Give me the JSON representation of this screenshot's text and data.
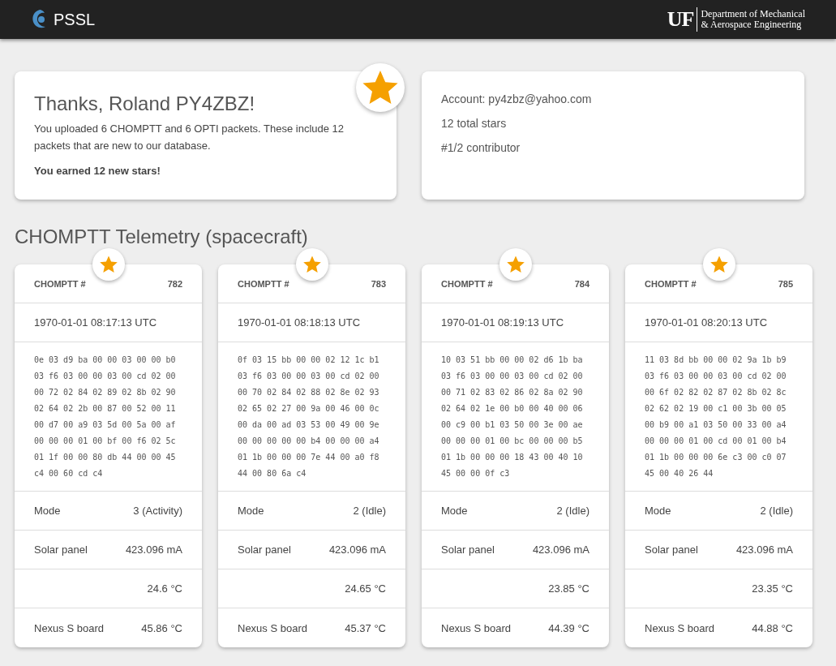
{
  "header": {
    "logo_text": "PSSL",
    "dept_line1": "Department of Mechanical",
    "dept_line2": "& Aerospace Engineering",
    "uf_text": "UF"
  },
  "thanks": {
    "title": "Thanks, Roland PY4ZBZ!",
    "message": "You uploaded 6 CHOMPTT and 6 OPTI packets. These include 12 packets that are new to our database.",
    "earned": "You earned 12 new stars!"
  },
  "account": {
    "lines": [
      "Account: py4zbz@yahoo.com",
      "12 total stars",
      "#1/2 contributor"
    ]
  },
  "section_title": "CHOMPTT Telemetry (spacecraft)",
  "packets": [
    {
      "label": "CHOMPTT #",
      "number": "782",
      "time": "1970-01-01 08:17:13 UTC",
      "hex": [
        "0e 03 d9 ba 00 00 03 00 00 b0",
        "03 f6 03 00 00 03 00 cd 02 00",
        "00 72 02 84 02 89 02 8b 02 90",
        "02 64 02 2b 00 87 00 52 00 11",
        "00 d7 00 a9 03 5d 00 5a 00 af",
        "00 00 00 01 00 bf 00 f6 02 5c",
        "01 1f 00 00 80 db 44 00 00 45",
        "c4 00 60 cd c4"
      ],
      "rows": [
        {
          "label": "Mode",
          "value": "3 (Activity)"
        },
        {
          "label": "Solar panel",
          "value": "423.096 mA"
        },
        {
          "label": "",
          "value": "24.6 °C"
        },
        {
          "label": "Nexus S board",
          "value": "45.86 °C"
        }
      ]
    },
    {
      "label": "CHOMPTT #",
      "number": "783",
      "time": "1970-01-01 08:18:13 UTC",
      "hex": [
        "0f 03 15 bb 00 00 02 12 1c b1",
        "03 f6 03 00 00 03 00 cd 02 00",
        "00 70 02 84 02 88 02 8e 02 93",
        "02 65 02 27 00 9a 00 46 00 0c",
        "00 da 00 ad 03 53 00 49 00 9e",
        "00 00 00 00 00 b4 00 00 00 a4",
        "01 1b 00 00 00 7e 44 00 a0 f8",
        "44 00 80 6a c4"
      ],
      "rows": [
        {
          "label": "Mode",
          "value": "2 (Idle)"
        },
        {
          "label": "Solar panel",
          "value": "423.096 mA"
        },
        {
          "label": "",
          "value": "24.65 °C"
        },
        {
          "label": "Nexus S board",
          "value": "45.37 °C"
        }
      ]
    },
    {
      "label": "CHOMPTT #",
      "number": "784",
      "time": "1970-01-01 08:19:13 UTC",
      "hex": [
        "10 03 51 bb 00 00 02 d6 1b ba",
        "03 f6 03 00 00 03 00 cd 02 00",
        "00 71 02 83 02 86 02 8a 02 90",
        "02 64 02 1e 00 b0 00 40 00 06",
        "00 c9 00 b1 03 50 00 3e 00 ae",
        "00 00 00 01 00 bc 00 00 00 b5",
        "01 1b 00 00 00 18 43 00 40 10",
        "45 00 00 0f c3"
      ],
      "rows": [
        {
          "label": "Mode",
          "value": "2 (Idle)"
        },
        {
          "label": "Solar panel",
          "value": "423.096 mA"
        },
        {
          "label": "",
          "value": "23.85 °C"
        },
        {
          "label": "Nexus S board",
          "value": "44.39 °C"
        }
      ]
    },
    {
      "label": "CHOMPTT #",
      "number": "785",
      "time": "1970-01-01 08:20:13 UTC",
      "hex": [
        "11 03 8d bb 00 00 02 9a 1b b9",
        "03 f6 03 00 00 03 00 cd 02 00",
        "00 6f 02 82 02 87 02 8b 02 8c",
        "02 62 02 19 00 c1 00 3b 00 05",
        "00 b9 00 a1 03 50 00 33 00 a4",
        "00 00 00 01 00 cd 00 01 00 b4",
        "01 1b 00 00 00 6e c3 00 c0 07",
        "45 00 40 26 44"
      ],
      "rows": [
        {
          "label": "Mode",
          "value": "2 (Idle)"
        },
        {
          "label": "Solar panel",
          "value": "423.096 mA"
        },
        {
          "label": "",
          "value": "23.35 °C"
        },
        {
          "label": "Nexus S board",
          "value": "44.88 °C"
        }
      ]
    }
  ]
}
